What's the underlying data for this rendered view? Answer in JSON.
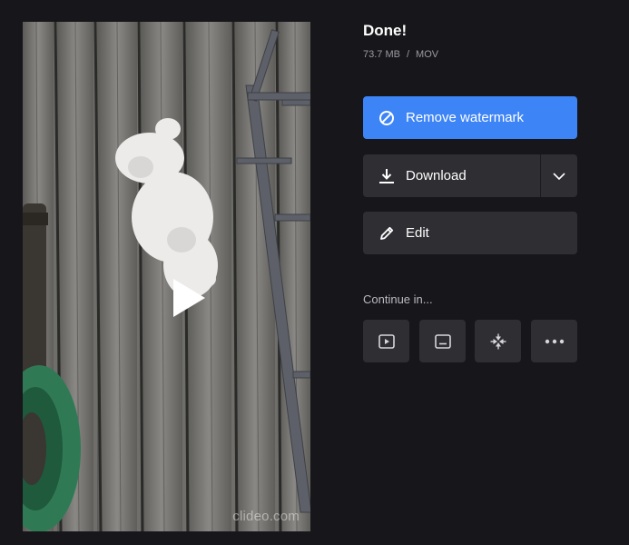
{
  "preview": {
    "watermark": "clideo.com"
  },
  "header": {
    "title": "Done!",
    "size": "73.7 MB",
    "separator": "/",
    "format": "MOV"
  },
  "actions": {
    "remove_watermark": "Remove watermark",
    "download": "Download",
    "edit": "Edit"
  },
  "continue": {
    "label": "Continue in...",
    "tools": [
      "video-player-icon",
      "subtitles-icon",
      "compress-icon",
      "more-icon"
    ]
  },
  "colors": {
    "background": "#17171b",
    "primary": "#3d84f7",
    "button": "#2e2e33"
  }
}
